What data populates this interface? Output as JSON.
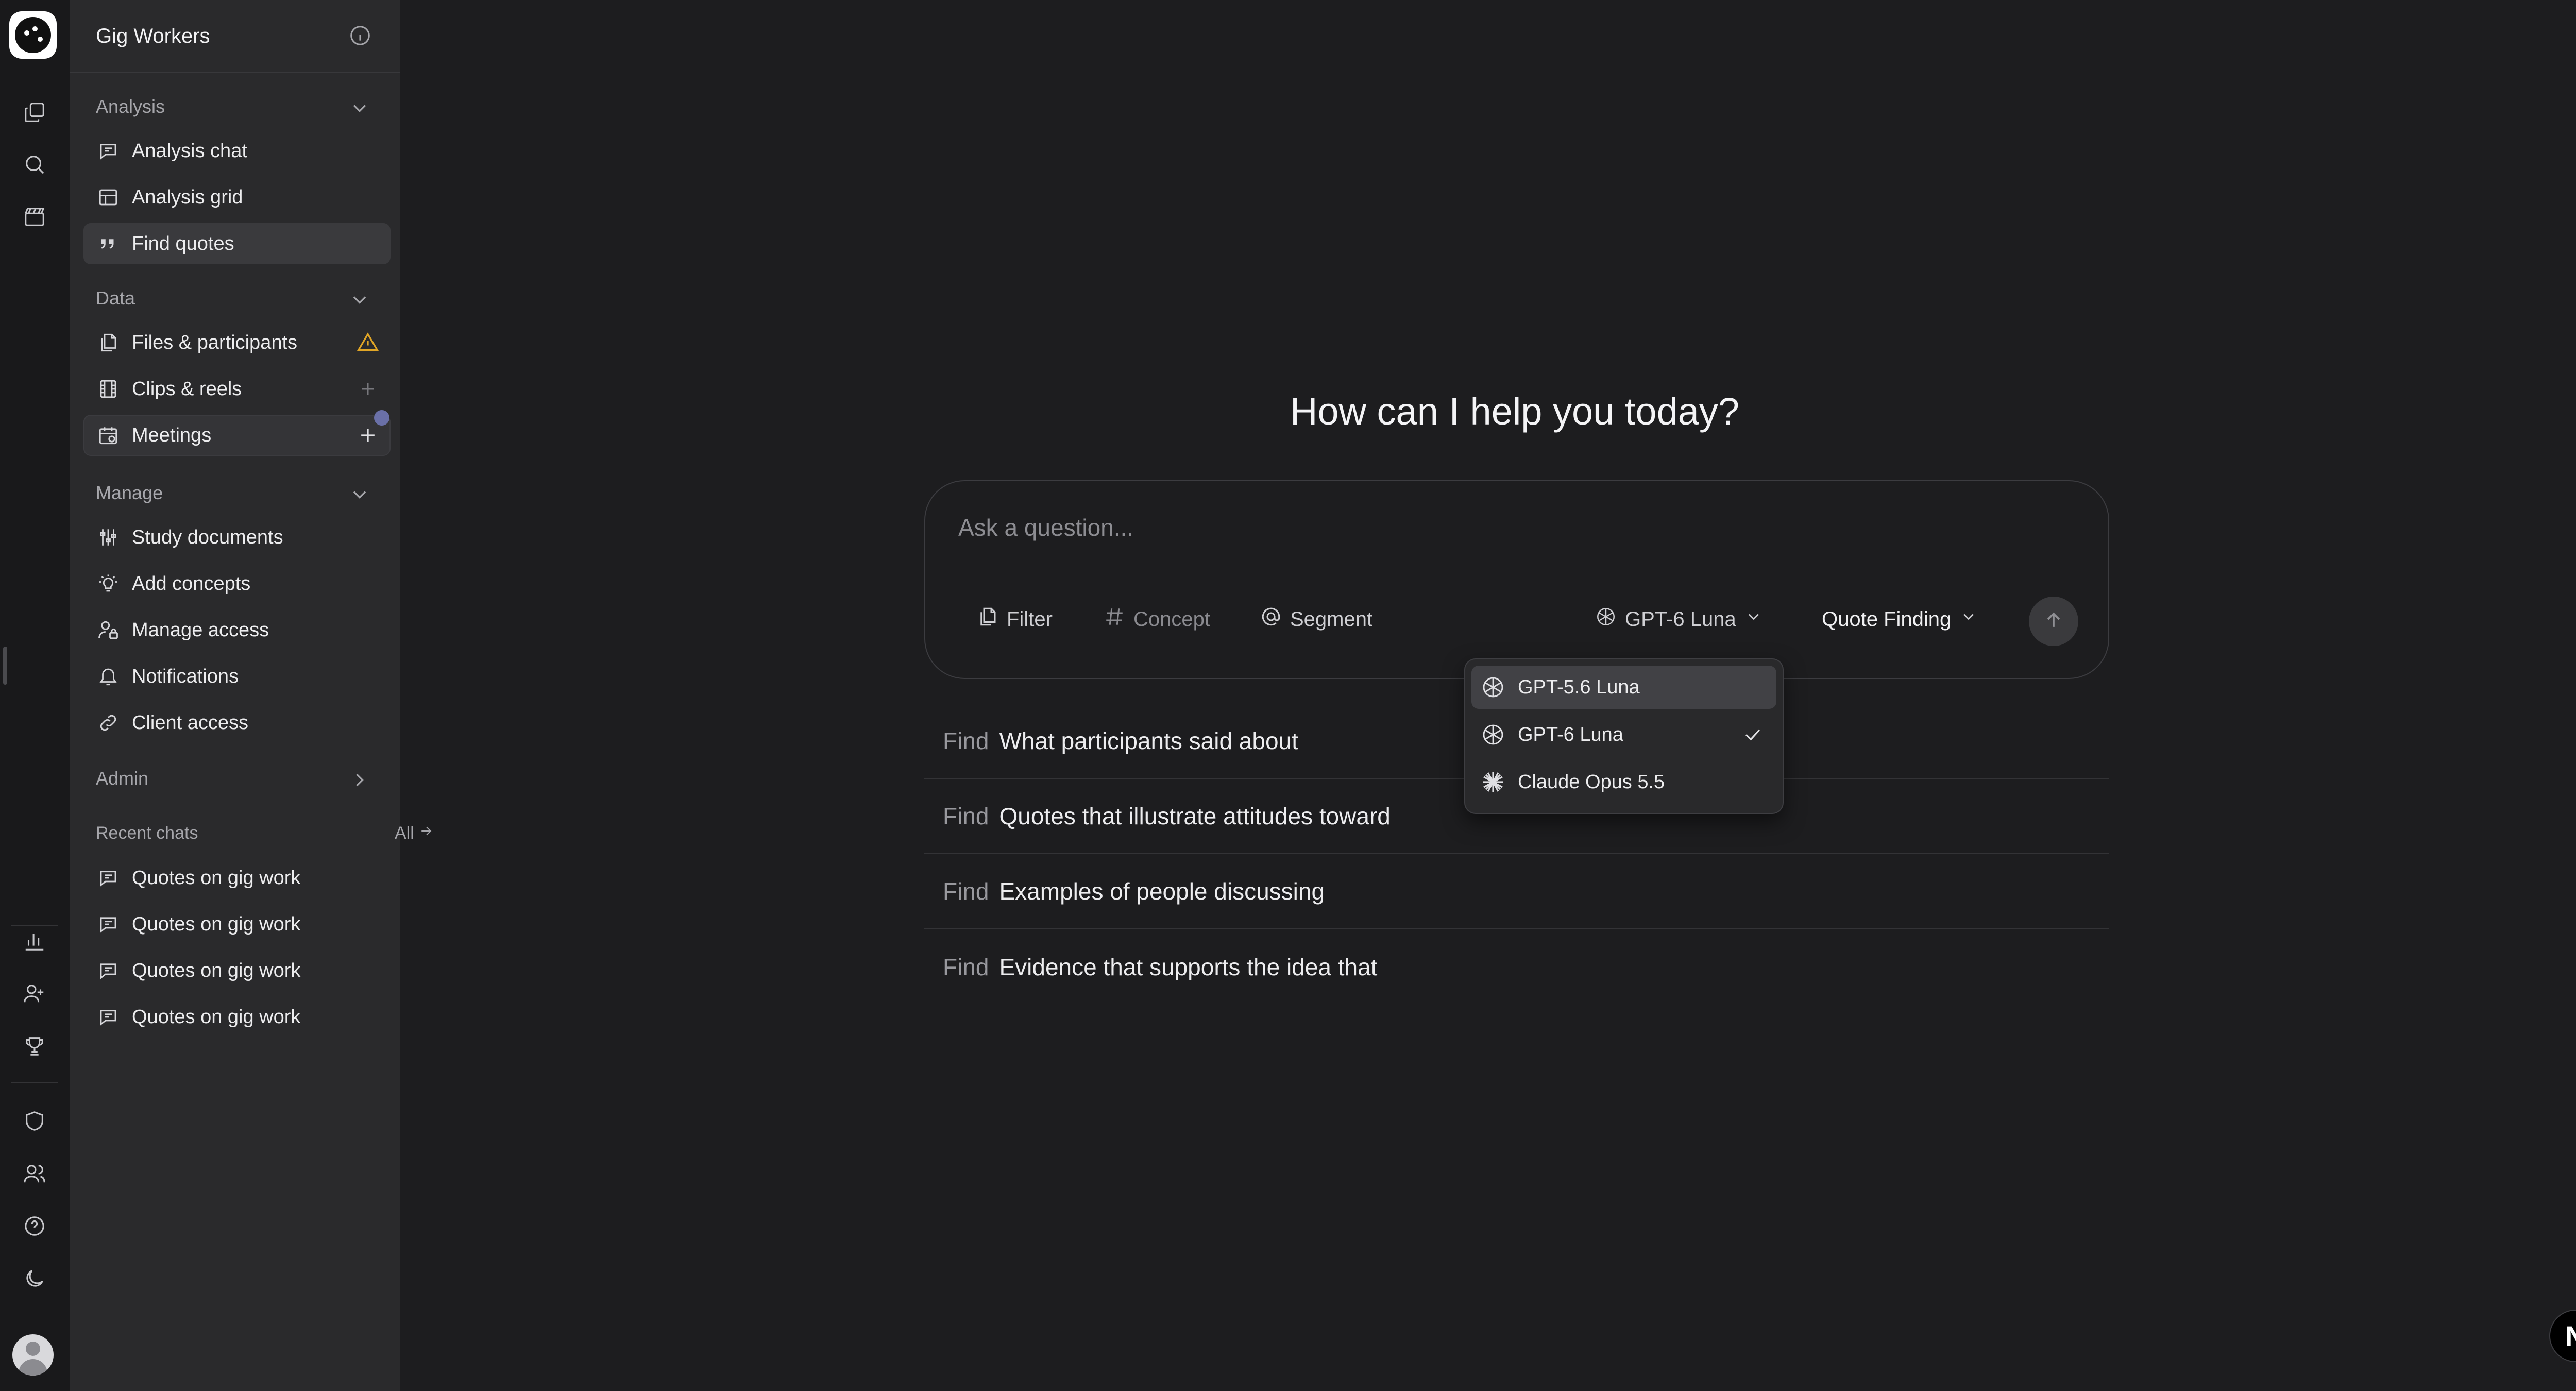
{
  "workspace": {
    "title": "Gig Workers"
  },
  "sidebar": {
    "analysis": {
      "label": "Analysis",
      "items": [
        {
          "label": "Analysis chat",
          "icon": "chat-icon"
        },
        {
          "label": "Analysis grid",
          "icon": "grid-icon"
        },
        {
          "label": "Find quotes",
          "icon": "quote-icon",
          "active": true
        }
      ]
    },
    "data": {
      "label": "Data",
      "items": [
        {
          "label": "Files & participants",
          "icon": "files-icon",
          "trailing": "warning-icon"
        },
        {
          "label": "Clips & reels",
          "icon": "film-icon",
          "trailing": "plus-icon"
        },
        {
          "label": "Meetings",
          "icon": "calendar-icon",
          "trailing": "plus-icon"
        }
      ]
    },
    "manage": {
      "label": "Manage",
      "items": [
        {
          "label": "Study documents",
          "icon": "sliders-icon"
        },
        {
          "label": "Add concepts",
          "icon": "lightbulb-icon"
        },
        {
          "label": "Manage access",
          "icon": "user-lock-icon"
        },
        {
          "label": "Notifications",
          "icon": "bell-icon"
        },
        {
          "label": "Client access",
          "icon": "link-icon"
        }
      ]
    },
    "admin": {
      "label": "Admin"
    },
    "recent": {
      "label": "Recent chats",
      "all_label": "All",
      "items": [
        {
          "label": "Quotes on gig work"
        },
        {
          "label": "Quotes on gig work"
        },
        {
          "label": "Quotes on gig work"
        },
        {
          "label": "Quotes on gig work"
        }
      ]
    }
  },
  "main": {
    "greeting": "How can I help you today?",
    "composer": {
      "placeholder": "Ask a question...",
      "filter_label": "Filter",
      "concept_label": "Concept",
      "segment_label": "Segment",
      "model_label": "GPT-6 Luna",
      "mode_label": "Quote Finding"
    },
    "model_menu": {
      "options": [
        {
          "label": "GPT-5.6 Luna",
          "icon": "openai-icon",
          "highlighted": true
        },
        {
          "label": "GPT-6 Luna",
          "icon": "openai-icon",
          "selected": true
        },
        {
          "label": "Claude Opus 5.5",
          "icon": "claude-spark-icon"
        }
      ]
    },
    "suggestions": [
      {
        "verb": "Find",
        "text": "What participants said about"
      },
      {
        "verb": "Find",
        "text": "Quotes that illustrate attitudes toward"
      },
      {
        "verb": "Find",
        "text": "Examples of people discussing"
      },
      {
        "verb": "Find",
        "text": "Evidence that supports the idea that"
      }
    ]
  },
  "badge": {
    "label": "N"
  },
  "colors": {
    "background": "#1d1d1f",
    "sidebar": "#2a2a2c",
    "rail": "#19191b",
    "active_item": "#3a3a3d",
    "warning": "#e0a526",
    "notification_dot": "#6a70a8"
  }
}
